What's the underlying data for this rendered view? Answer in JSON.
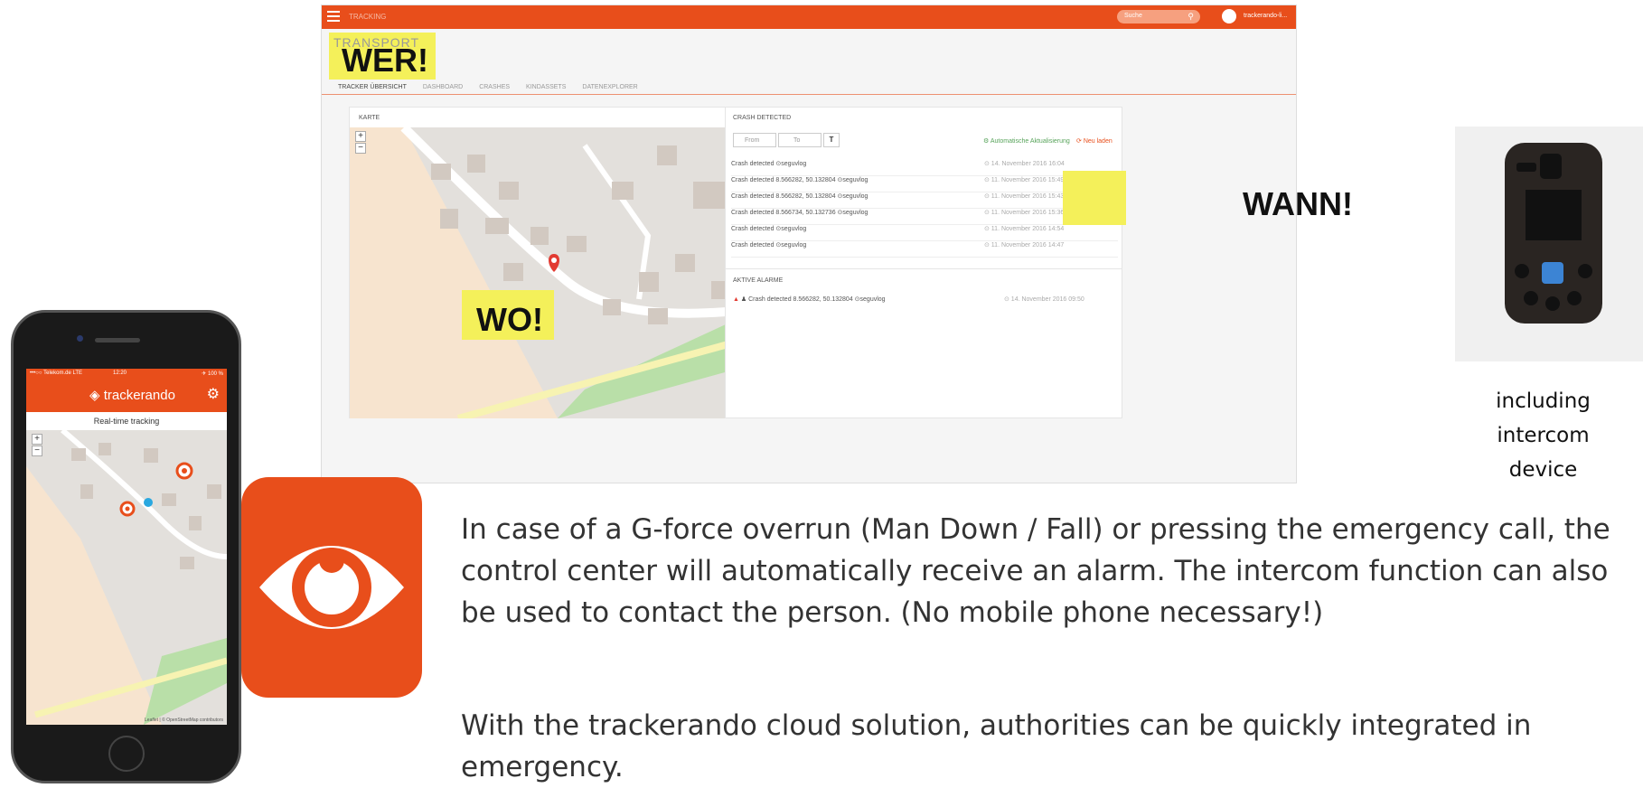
{
  "dashboard": {
    "topbar": {
      "title": "TRACKING",
      "search_placeholder": "Suche",
      "user": "trackerando-li..."
    },
    "brand_ghost": "TRANSPORT",
    "tabs": [
      "TRACKER ÜBERSICHT",
      "DASHBOARD",
      "CRASHES",
      "KINDASSETS",
      "DATENEXPLORER"
    ],
    "karte": {
      "header": "KARTE",
      "zoom_in": "+",
      "zoom_out": "−"
    },
    "crash": {
      "header": "CRASH DETECTED",
      "from_placeholder": "From",
      "to_placeholder": "To",
      "auto_update": "Automatische Aktualisierung",
      "reload": "Neu laden",
      "rows": [
        {
          "text": "Crash detected ⊙seguvlog",
          "date": "⊙ 14. November 2016 16:04"
        },
        {
          "text": "Crash detected 8.566282, 50.132804 ⊙seguvlog",
          "date": "⊙ 11. November 2016 15:49"
        },
        {
          "text": "Crash detected 8.566282, 50.132804 ⊙seguvlog",
          "date": "⊙ 11. November 2016 15:43"
        },
        {
          "text": "Crash detected 8.566734, 50.132736 ⊙seguvlog",
          "date": "⊙ 11. November 2016 15:36"
        },
        {
          "text": "Crash detected ⊙seguvlog",
          "date": "⊙ 11. November 2016 14:54"
        },
        {
          "text": "Crash detected ⊙seguvlog",
          "date": "⊙ 11. November 2016 14:47"
        }
      ]
    },
    "alarms": {
      "header": "AKTIVE ALARME",
      "row_text": "Crash detected 8.566282, 50.132804 ⊙seguvlog",
      "row_date": "⊙ 14. November 2016 09:50"
    }
  },
  "labels": {
    "wer": "WER!",
    "wo": "WO!",
    "wann": "WANN!"
  },
  "phone": {
    "carrier": "•••○○ Telekom.de LTE",
    "time": "12:20",
    "battery": "✈ 100 %",
    "app_name": "trackerando",
    "subtitle": "Real-time tracking",
    "attribution": "Leaflet | © OpenStreetMap contributors"
  },
  "device_caption": "including intercom device",
  "paragraphs": {
    "p1": "In case of a G-force overrun (Man Down / Fall) or pressing the emergency call, the control center will automatically receive an alarm. The intercom function can also be used to contact the person. (No mobile phone necessary!)",
    "p2": "With the trackerando cloud solution, authorities can be quickly integrated in emergency."
  },
  "colors": {
    "brand": "#e84e1b",
    "highlight": "#f4f05a",
    "green": "#9fd39a"
  }
}
